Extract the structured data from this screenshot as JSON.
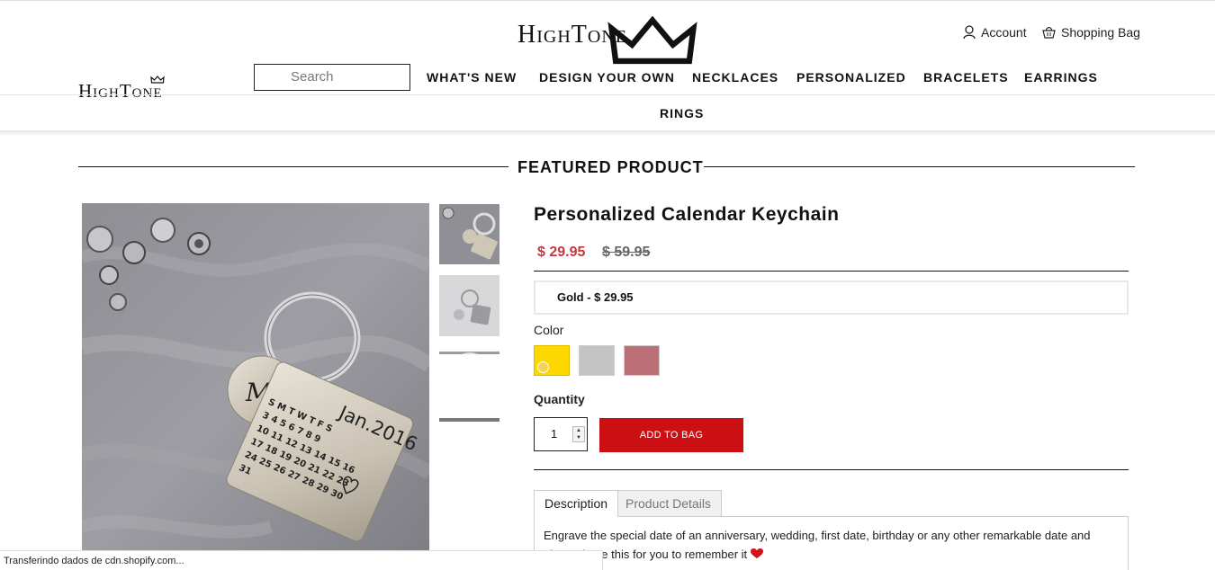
{
  "header": {
    "brand": "HighTone",
    "account_label": "Account",
    "bag_label": "Shopping Bag",
    "search_placeholder": "Search",
    "nav": [
      "WHAT'S NEW",
      "DESIGN YOUR OWN",
      "NECKLACES",
      "PERSONALIZED",
      "BRACELETS",
      "EARRINGS",
      "RINGS"
    ]
  },
  "section": {
    "title": "FEATURED PRODUCT"
  },
  "product": {
    "title": "Personalized Calendar Keychain",
    "price": "$ 29.95",
    "compare_price": "$ 59.95",
    "variant": "Gold - $ 29.95",
    "color_label": "Color",
    "colors": [
      "#ffd700",
      "#c4c4c4",
      "#bd6f78"
    ],
    "selected_color_index": 0,
    "quantity_label": "Quantity",
    "quantity": "1",
    "add_to_bag": "ADD TO BAG",
    "image_text": {
      "month": "Jan.2016",
      "monogram": "M&P"
    },
    "tabs": [
      "Description",
      "Product Details"
    ],
    "active_tab": "Description",
    "description": "Engrave the special date of an anniversary, wedding, first date, birthday or any other remarkable date and always have this for you to remember it"
  },
  "status_bar": "Transferindo dados de cdn.shopify.com...",
  "colors": {
    "sale_red": "#c8363c",
    "button_red": "#cc0f12"
  }
}
